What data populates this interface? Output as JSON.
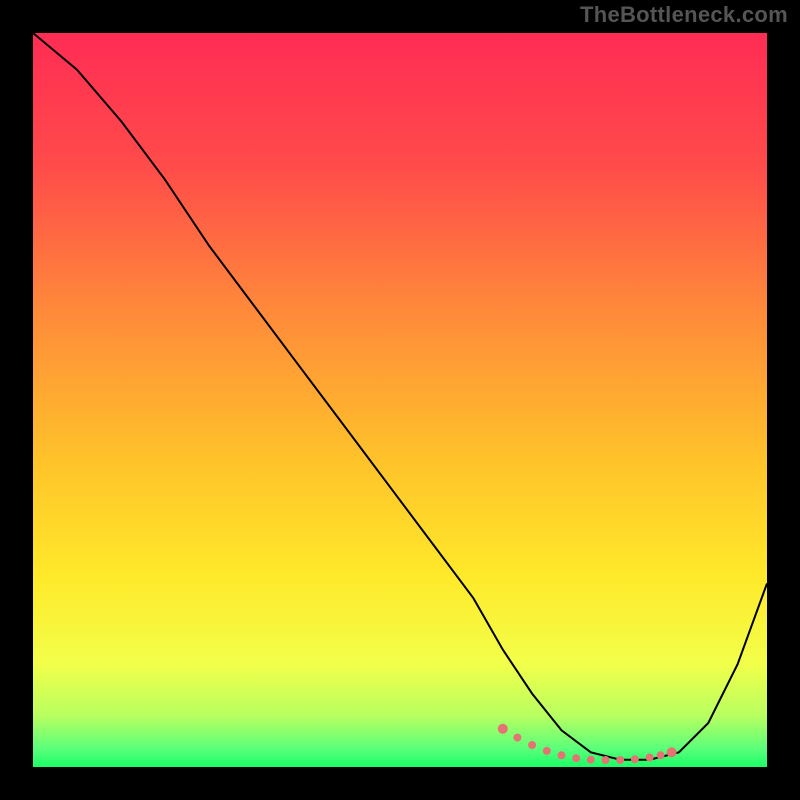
{
  "attribution": "TheBottleneck.com",
  "chart_data": {
    "type": "line",
    "title": "",
    "xlabel": "",
    "ylabel": "",
    "xlim": [
      0,
      100
    ],
    "ylim": [
      0,
      100
    ],
    "grid": false,
    "legend": false,
    "series": [
      {
        "name": "curve",
        "color": "#000000",
        "x": [
          0,
          6,
          12,
          18,
          24,
          30,
          36,
          42,
          48,
          54,
          60,
          64,
          68,
          72,
          76,
          80,
          84,
          88,
          92,
          96,
          100
        ],
        "values": [
          100,
          95,
          88,
          80,
          71,
          63,
          55,
          47,
          39,
          31,
          23,
          16,
          10,
          5,
          2,
          1,
          1,
          2,
          6,
          14,
          25
        ]
      }
    ],
    "highlight": {
      "name": "optimal-range",
      "color": "#e57373",
      "x": [
        64,
        66,
        68,
        70,
        72,
        74,
        76,
        78,
        80,
        82,
        84,
        85.5,
        87
      ],
      "values": [
        5.2,
        4.0,
        3.0,
        2.2,
        1.6,
        1.2,
        1.0,
        0.95,
        0.95,
        1.05,
        1.3,
        1.6,
        2.0
      ]
    },
    "background_gradient": {
      "stops": [
        {
          "offset": 0.0,
          "color": "#ff2c54"
        },
        {
          "offset": 0.18,
          "color": "#ff4b4a"
        },
        {
          "offset": 0.38,
          "color": "#ff8a3a"
        },
        {
          "offset": 0.58,
          "color": "#ffc22a"
        },
        {
          "offset": 0.74,
          "color": "#ffe92a"
        },
        {
          "offset": 0.86,
          "color": "#f2ff4a"
        },
        {
          "offset": 0.93,
          "color": "#b8ff60"
        },
        {
          "offset": 0.975,
          "color": "#5bff7a"
        },
        {
          "offset": 1.0,
          "color": "#1aff66"
        }
      ]
    }
  }
}
